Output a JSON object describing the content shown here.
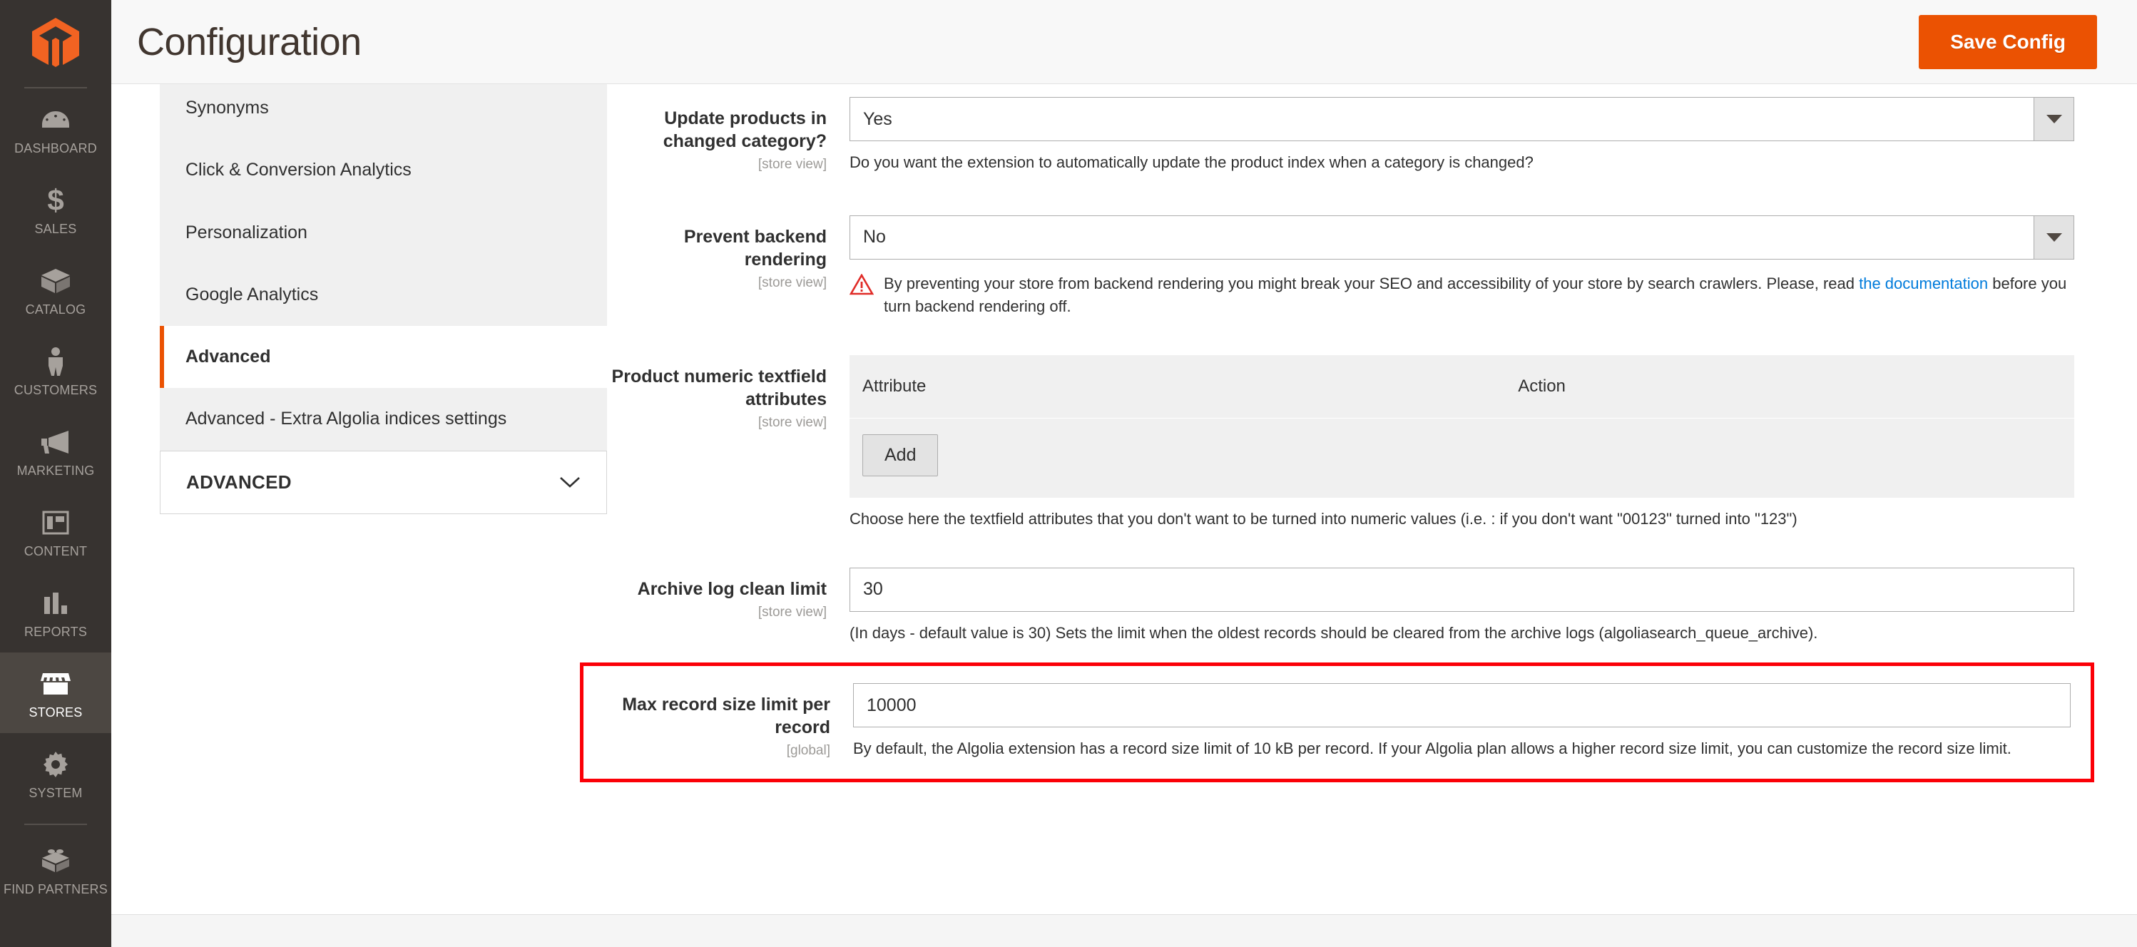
{
  "admin_sidebar": {
    "logo_name": "magento-logo",
    "items": [
      {
        "label": "DASHBOARD",
        "icon": "dashboard-gauge-icon",
        "active": false
      },
      {
        "label": "SALES",
        "icon": "dollar-sign-icon",
        "active": false
      },
      {
        "label": "CATALOG",
        "icon": "box-icon",
        "active": false
      },
      {
        "label": "CUSTOMERS",
        "icon": "person-icon",
        "active": false
      },
      {
        "label": "MARKETING",
        "icon": "megaphone-icon",
        "active": false
      },
      {
        "label": "CONTENT",
        "icon": "layout-panel-icon",
        "active": false
      },
      {
        "label": "REPORTS",
        "icon": "bar-chart-icon",
        "active": false
      },
      {
        "label": "STORES",
        "icon": "storefront-icon",
        "active": true
      },
      {
        "label": "SYSTEM",
        "icon": "gear-icon",
        "active": false
      },
      {
        "label": "FIND PARTNERS",
        "icon": "lego-brick-icon",
        "active": false
      }
    ]
  },
  "header": {
    "title": "Configuration",
    "save_label": "Save Config"
  },
  "config_nav": {
    "items": [
      {
        "label": "Synonyms",
        "active": false
      },
      {
        "label": "Click & Conversion Analytics",
        "active": false
      },
      {
        "label": "Personalization",
        "active": false
      },
      {
        "label": "Google Analytics",
        "active": false
      },
      {
        "label": "Advanced",
        "active": true
      },
      {
        "label": "Advanced - Extra Algolia indices settings",
        "active": false
      }
    ],
    "group": {
      "label": "ADVANCED",
      "chevron_icon": "chevron-down-icon"
    }
  },
  "form": {
    "update_products": {
      "label": "Update products in changed category?",
      "scope": "[store view]",
      "value": "Yes",
      "options": [
        "Yes",
        "No"
      ],
      "note": "Do you want the extension to automatically update the product index when a category is changed?"
    },
    "prevent_backend": {
      "label": "Prevent backend rendering",
      "scope": "[store view]",
      "value": "No",
      "options": [
        "Yes",
        "No"
      ],
      "warn_icon": "warning-triangle-icon",
      "warn_text_1": "By preventing your store from backend rendering you might break your SEO and accessibility of your store by search crawlers. Please, read ",
      "warn_link": "the documentation",
      "warn_text_2": " before you turn backend rendering off."
    },
    "numeric_attributes": {
      "label": "Product numeric textfield attributes",
      "scope": "[store view]",
      "columns": [
        "Attribute",
        "Action"
      ],
      "rows": [],
      "add_label": "Add",
      "note": "Choose here the textfield attributes that you don't want to be turned into numeric values (i.e. : if you don't want \"00123\" turned into \"123\")"
    },
    "archive_log": {
      "label": "Archive log clean limit",
      "scope": "[store view]",
      "value": "30",
      "note": "(In days - default value is 30) Sets the limit when the oldest records should be cleared from the archive logs (algoliasearch_queue_archive)."
    },
    "max_record_size": {
      "label": "Max record size limit per record",
      "scope": "[global]",
      "value": "10000",
      "note": "By default, the Algolia extension has a record size limit of 10 kB per record. If your Algolia plan allows a higher record size limit, you can customize the record size limit.",
      "highlighted": true
    }
  },
  "colors": {
    "accent_orange": "#eb5202",
    "sidebar_dark": "#373330",
    "highlight_red": "#fb0007",
    "link_blue": "#007bdb"
  }
}
